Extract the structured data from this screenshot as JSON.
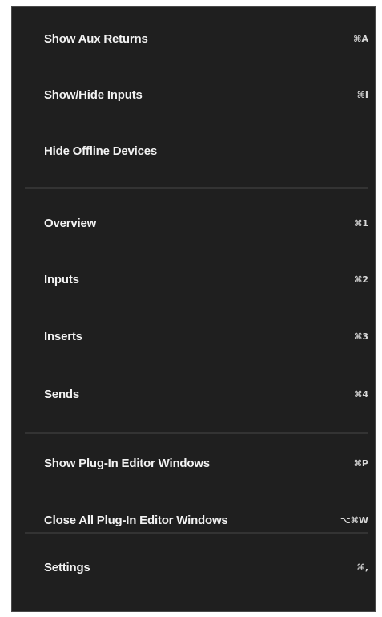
{
  "menu": {
    "items": [
      {
        "label": "Show Aux Returns",
        "shortcut": "⌘A"
      },
      {
        "label": "Show/Hide Inputs",
        "shortcut": "⌘I"
      },
      {
        "label": "Hide Offline Devices",
        "shortcut": ""
      },
      {
        "label": "Overview",
        "shortcut": "⌘1"
      },
      {
        "label": "Inputs",
        "shortcut": "⌘2"
      },
      {
        "label": "Inserts",
        "shortcut": "⌘3"
      },
      {
        "label": "Sends",
        "shortcut": "⌘4"
      },
      {
        "label": "Show Plug-In Editor Windows",
        "shortcut": "⌘P"
      },
      {
        "label": "Close All Plug-In Editor Windows",
        "shortcut": "⌥⌘W"
      },
      {
        "label": "Settings",
        "shortcut": "⌘,"
      }
    ]
  },
  "colors": {
    "menu_background": "#1f1f1f",
    "text": "#f2f2f2",
    "separator": "#333333"
  }
}
